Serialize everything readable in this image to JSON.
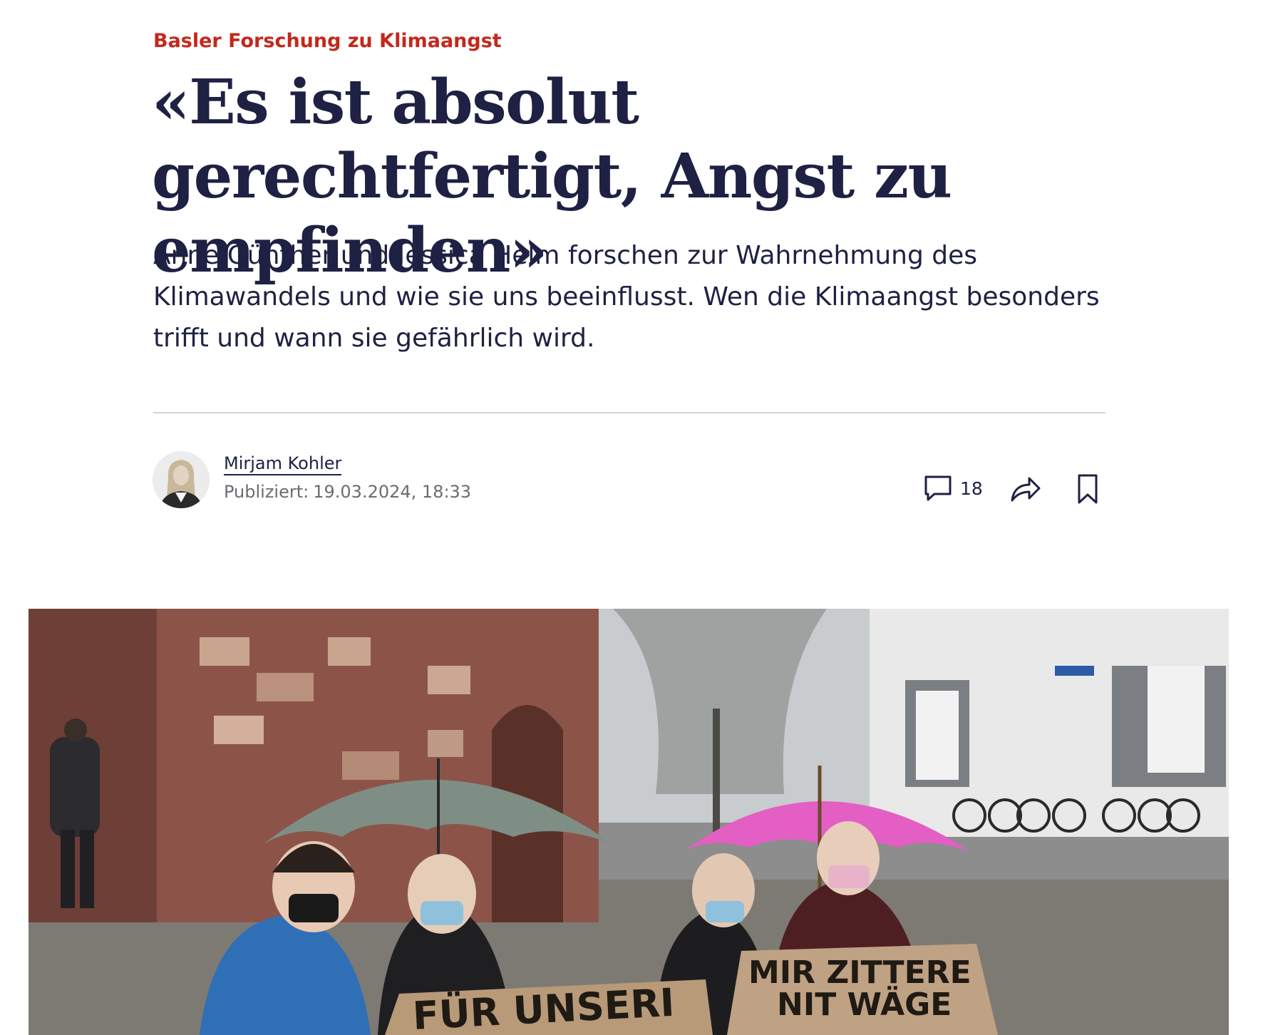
{
  "article": {
    "kicker": "Basler Forschung zu Klimaangst",
    "headline": "«Es ist absolut gerechtfertigt, Angst zu empfinden»",
    "lead": "Anne Günther und Jessica Helm forschen zur Wahrnehmung des Klimawandels und wie sie uns beeinflusst. Wen die Klimaangst besonders trifft und wann sie gefährlich wird."
  },
  "byline": {
    "author": "Mirjam Kohler",
    "published_label": "Publiziert:",
    "published_value": "19.03.2024, 18:33"
  },
  "actions": {
    "comment_icon": "speech-bubble-icon",
    "comment_count": "18",
    "share_icon": "share-arrow-icon",
    "bookmark_icon": "bookmark-icon"
  },
  "hero_image": {
    "sign_left": "FÜR UNSERI",
    "sign_right_line1": "MIR ZITTERE",
    "sign_right_line2": "NIT WÄGE"
  },
  "colors": {
    "kicker": "#c4281c",
    "text": "#1e2143",
    "meta": "#6b6b73",
    "divider": "#d4d4d8"
  }
}
